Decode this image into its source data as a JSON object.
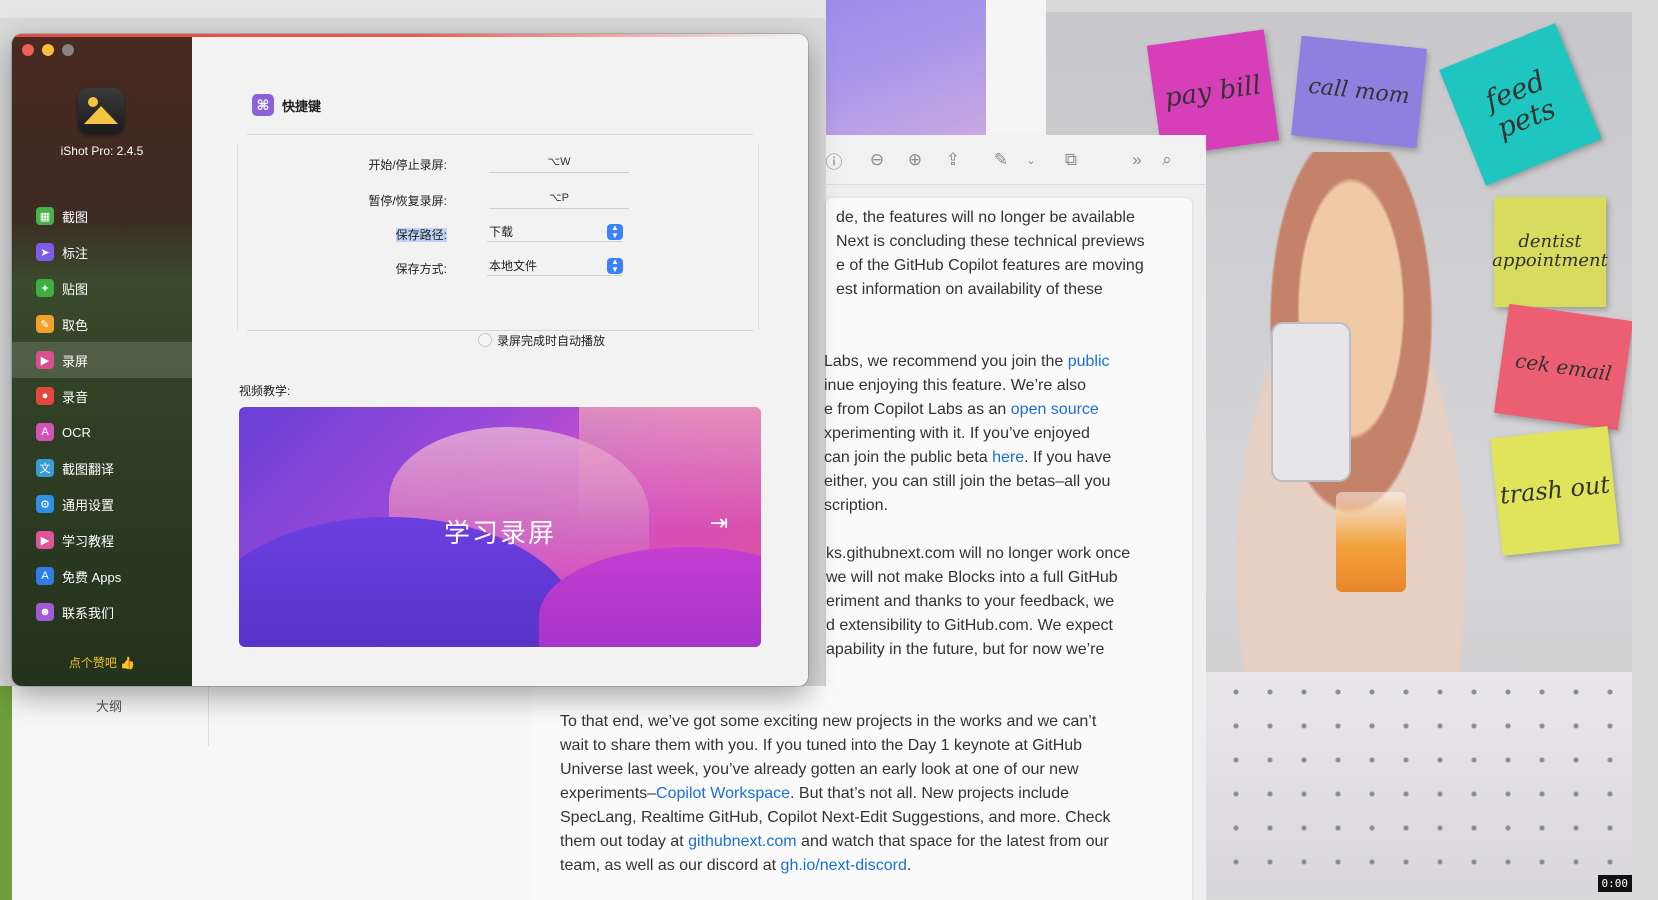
{
  "app": {
    "name": "iShot Pro: 2.4.5",
    "like_text": "点个赞吧 👍",
    "colors": {
      "accent": "#3b82f6",
      "sidebar_active": "rgba(255,255,255,0.14)",
      "section_badge": "#8a63d8"
    }
  },
  "sidebar": {
    "items": [
      {
        "label": "截图",
        "icon": "image-icon",
        "color": "#49b04b",
        "glyph": "▦"
      },
      {
        "label": "标注",
        "icon": "pointer-icon",
        "color": "#7c5be6",
        "glyph": "➤"
      },
      {
        "label": "贴图",
        "icon": "pin-icon",
        "color": "#3cb043",
        "glyph": "✦"
      },
      {
        "label": "取色",
        "icon": "eyedropper-icon",
        "color": "#f0a12a",
        "glyph": "✎"
      },
      {
        "label": "录屏",
        "icon": "video-icon",
        "color": "#d94f8f",
        "glyph": "▶"
      },
      {
        "label": "录音",
        "icon": "microphone-icon",
        "color": "#e2473e",
        "glyph": "●"
      },
      {
        "label": "OCR",
        "icon": "ocr-icon",
        "color": "#d352b8",
        "glyph": "A"
      },
      {
        "label": "截图翻译",
        "icon": "translate-icon",
        "color": "#3a9bd9",
        "glyph": "文"
      },
      {
        "label": "通用设置",
        "icon": "gear-icon",
        "color": "#2f8fe0",
        "glyph": "⚙"
      },
      {
        "label": "学习教程",
        "icon": "play-icon",
        "color": "#e0559a",
        "glyph": "▶"
      },
      {
        "label": "免费 Apps",
        "icon": "appstore-icon",
        "color": "#2f7ee8",
        "glyph": "A"
      },
      {
        "label": "联系我们",
        "icon": "contacts-icon",
        "color": "#a05ad8",
        "glyph": "☻"
      }
    ],
    "active_index": 4
  },
  "settings": {
    "section_title": "快捷键",
    "section_icon": "command-icon",
    "start_stop_label": "开始/停止录屏:",
    "start_stop_shortcut": "⌥W",
    "pause_resume_label": "暂停/恢复录屏:",
    "pause_resume_shortcut": "⌥P",
    "save_path_label": "保存路径:",
    "save_path_value": "下载",
    "save_mode_label": "保存方式:",
    "save_mode_value": "本地文件",
    "autoplay_label": "录屏完成时自动播放",
    "autoplay_checked": false,
    "video_tutorial_label": "视频教学:",
    "video_title": "学习录屏"
  },
  "underlying": {
    "outline_label": "大纲"
  },
  "document": {
    "lines_top": [
      "de, the features will no longer be available",
      "Next is concluding these technical previews",
      "e of the GitHub Copilot features are moving",
      "est information on availability of these"
    ],
    "para2": [
      {
        "pre": "Labs, we recommend you join the ",
        "link": "public",
        "post": ""
      },
      {
        "pre": "inue enjoying this feature. We’re also",
        "link": "",
        "post": ""
      },
      {
        "pre": "e from Copilot Labs as an ",
        "link": "open source",
        "post": ""
      },
      {
        "pre": "xperimenting with it. If you’ve enjoyed",
        "link": "",
        "post": ""
      },
      {
        "pre": "can join the public beta ",
        "link": "here",
        "post": ". If you have"
      },
      {
        "pre": "either, you can still join the betas–all you",
        "link": "",
        "post": ""
      },
      {
        "pre": "scription.",
        "link": "",
        "post": ""
      }
    ],
    "para3": [
      "ks.githubnext.com will no longer work once",
      " we will not make Blocks into a full GitHub",
      "eriment and thanks to your feedback, we",
      "d extensibility to GitHub.com. We expect",
      "apability in the future, but for now we’re"
    ],
    "para4": [
      {
        "pre": "To that end, we’ve got some exciting new projects in the works and we can’t",
        "link": "",
        "post": ""
      },
      {
        "pre": "wait to share them with you. If you tuned into the Day 1 keynote at GitHub",
        "link": "",
        "post": ""
      },
      {
        "pre": "Universe last week, you’ve already gotten an early look at one of our new",
        "link": "",
        "post": ""
      },
      {
        "pre": "experiments–",
        "link": "Copilot Workspace",
        "post": ". But that’s not all. New projects include"
      },
      {
        "pre": "SpecLang, Realtime GitHub, Copilot Next-Edit Suggestions, and more. Check",
        "link": "",
        "post": ""
      },
      {
        "pre": "them out today at ",
        "link": "githubnext.com",
        "post": " and watch that space for the latest from our"
      },
      {
        "pre": "team, as well as our discord at ",
        "link": "gh.io/next-discord",
        "post": "."
      }
    ]
  },
  "photo": {
    "notes": [
      "pay bill",
      "call mom",
      "feed pets",
      "dentist appointment",
      "cek email",
      "trash out"
    ],
    "timestamp": "0:00"
  }
}
